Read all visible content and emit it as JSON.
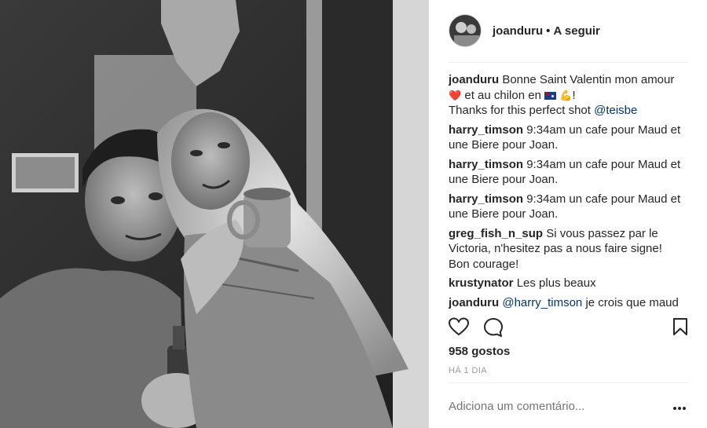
{
  "post": {
    "username": "joanduru",
    "separator": "•",
    "follow_label": "A seguir",
    "likes": "958 gostos",
    "time": "HÁ 1 DIA",
    "add_comment_placeholder": "Adiciona um comentário...",
    "photo_icon": "photo-two-people",
    "avatar_icon": "profile-avatar"
  },
  "caption": {
    "user": "joanduru",
    "text_1": " Bonne Saint Valentin mon amour",
    "heart": "❤️",
    "text_2": " et au chilon en ",
    "muscle": "💪",
    "text_3": "!",
    "text_4": "Thanks for this perfect shot ",
    "mention": "@teisbe"
  },
  "comments": [
    {
      "user": "harry_timson",
      "text": " 9:34am un cafe pour Maud et une Biere pour Joan."
    },
    {
      "user": "harry_timson",
      "text": " 9:34am un cafe pour Maud et une Biere pour Joan."
    },
    {
      "user": "harry_timson",
      "text": " 9:34am un cafe pour Maud et une Biere pour Joan."
    },
    {
      "user": "greg_fish_n_sup",
      "text": " Si vous passez par le Victoria, n'hesitez pas a nous faire signe! Bon courage!"
    },
    {
      "user": "krustynator",
      "text": " Les plus beaux"
    },
    {
      "user": "joanduru",
      "mention": "@harry_timson",
      "text": " je crois que maud"
    }
  ],
  "icons": {
    "like": "heart-outline-icon",
    "comment": "speech-bubble-icon",
    "save": "bookmark-icon",
    "more": "more-options-icon"
  },
  "colors": {
    "text": "#262626",
    "muted": "#999999",
    "mention": "#003569",
    "divider": "#efefef"
  }
}
